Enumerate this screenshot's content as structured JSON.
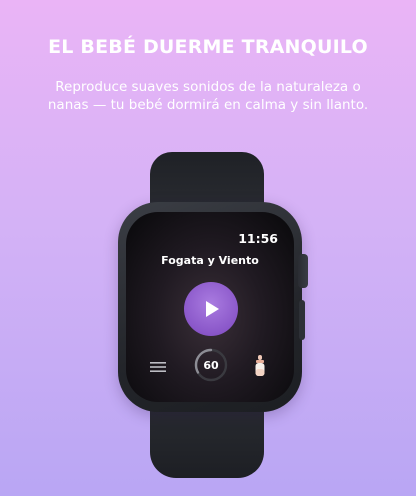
{
  "promo": {
    "headline": "EL BEBÉ DUERME TRANQUILO",
    "subtitle": "Reproduce suaves sonidos de la naturaleza o nanas — tu bebé dormirá en calma y sin llanto."
  },
  "watch": {
    "time": "11:56",
    "track_title": "Fogata y Viento",
    "timer_value": "60",
    "icons": {
      "menu": "hamburger-menu-icon",
      "play": "play-icon",
      "timer": "timer-ring-icon",
      "bottle": "baby-bottle-icon"
    }
  },
  "colors": {
    "background_top": "#eab4f6",
    "background_bottom": "#b9a6f4",
    "play_button": "#8a57c9",
    "watch_body": "#23252b"
  }
}
